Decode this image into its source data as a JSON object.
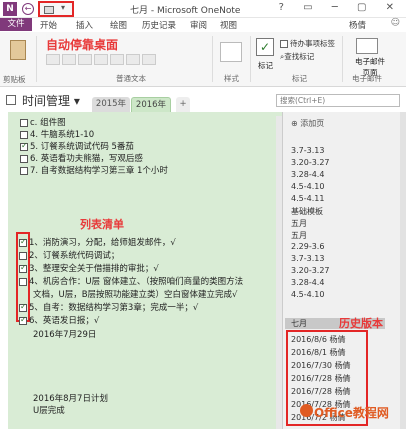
{
  "titlebar": {
    "app_icon": "N",
    "title": "七月 - Microsoft OneNote",
    "controls": "? ▭ ─ ▢ ✕"
  },
  "ribbon_tabs": [
    {
      "label": "文件"
    },
    {
      "label": "开始"
    },
    {
      "label": "插入"
    },
    {
      "label": "绘图"
    },
    {
      "label": "历史记录"
    },
    {
      "label": "审阅"
    },
    {
      "label": "视图"
    }
  ],
  "user": "杨倩",
  "ribbon": {
    "clipboard_label": "剪贴板",
    "basic_text_label": "普通文本",
    "styles_label": "样式",
    "tag_label": "标记",
    "tags_group_label": "标记",
    "todo_label": "待办事项标签",
    "find_tag_label": "查找标记",
    "email_label": "电子邮件\n页面",
    "email_group_label": "电子邮件",
    "annotation": "自动停靠桌面"
  },
  "notebook": {
    "title": "时间管理",
    "sections": [
      "2015年",
      "2016年",
      "+"
    ],
    "search_placeholder": "搜索(Ctrl+E)"
  },
  "content": {
    "top_lines": [
      {
        "checked": false,
        "text": "c. 组件图"
      },
      {
        "checked": false,
        "text": "4. 牛脑系统1-10"
      },
      {
        "checked": true,
        "text": "5. 订餐系统调试代码 5番茄"
      },
      {
        "checked": false,
        "text": "6. 英语看功夫熊猫，写观后感"
      },
      {
        "checked": false,
        "text": "7. 自考数据结构学习第三章  1个小时"
      }
    ],
    "list_label": "列表清单",
    "list_lines": [
      {
        "checked": true,
        "text": "1、消防演习，分配，给师姐发邮件，√"
      },
      {
        "checked": false,
        "text": "2、订餐系统代码调试；"
      },
      {
        "checked": true,
        "text": "3、整理安全关于借描排的审批；√"
      },
      {
        "checked": false,
        "text": "4、机房合作：U层 窗体建立、（按照咱们商量的类图方法"
      },
      {
        "checked": false,
        "text": "文档，U层，B层按照功能建立类）空白窗体建立完成√"
      },
      {
        "checked": true,
        "text": "5、自考：数据结构学习第3章；完成一半；√"
      },
      {
        "checked": true,
        "text": "6、英语发日报；√"
      }
    ],
    "date_line": "2016年7月29日",
    "bottom_lines": [
      "2016年8月7日计划",
      "U层完成"
    ]
  },
  "pages_pane": {
    "add_page": "添加页",
    "pages": [
      "3.7-3.13",
      "3.20-3.27",
      "3.28-4.4",
      "4.5-4.10",
      "4.5-4.11",
      "基础模板",
      "五月",
      "五月",
      "2.29-3.6",
      "3.7-3.13",
      "3.20-3.27",
      "3.28-4.4",
      "4.5-4.10"
    ],
    "selected_page": "七月",
    "history_label": "历史版本",
    "history": [
      "2016/8/6 杨倩",
      "2016/8/1 杨倩",
      "2016/7/30 杨倩",
      "2016/7/28 杨倩",
      "2016/7/28 杨倩",
      "2016/7/28 杨倩",
      "2016/7/2 杨倩"
    ]
  },
  "watermark": "Office教程网"
}
